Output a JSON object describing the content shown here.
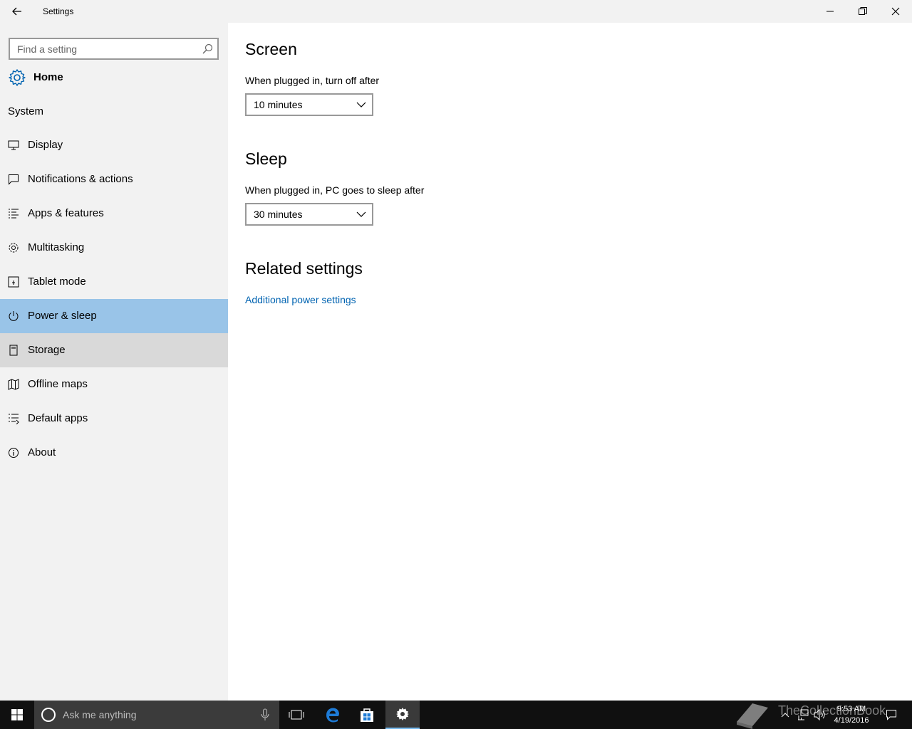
{
  "window": {
    "title": "Settings"
  },
  "sidebar": {
    "search_placeholder": "Find a setting",
    "home_label": "Home",
    "section_label": "System",
    "items": [
      {
        "label": "Display",
        "icon": "monitor-icon"
      },
      {
        "label": "Notifications & actions",
        "icon": "message-icon"
      },
      {
        "label": "Apps & features",
        "icon": "list-icon"
      },
      {
        "label": "Multitasking",
        "icon": "gear-icon"
      },
      {
        "label": "Tablet mode",
        "icon": "tablet-icon"
      },
      {
        "label": "Power & sleep",
        "icon": "power-icon",
        "selected": true
      },
      {
        "label": "Storage",
        "icon": "storage-icon",
        "hovered": true
      },
      {
        "label": "Offline maps",
        "icon": "map-icon"
      },
      {
        "label": "Default apps",
        "icon": "default-apps-icon"
      },
      {
        "label": "About",
        "icon": "info-icon"
      }
    ]
  },
  "main": {
    "screen": {
      "heading": "Screen",
      "label": "When plugged in, turn off after",
      "value": "10 minutes"
    },
    "sleep": {
      "heading": "Sleep",
      "label": "When plugged in, PC goes to sleep after",
      "value": "30 minutes"
    },
    "related": {
      "heading": "Related settings",
      "link": "Additional power settings"
    }
  },
  "taskbar": {
    "search_placeholder": "Ask me anything",
    "time": "9:53 AM",
    "date": "4/19/2016",
    "watermark": "TheCollectionBook"
  },
  "colors": {
    "selected": "#99c4e8",
    "hover": "#d9d9d9",
    "link": "#0063b1",
    "accent": "#76b9ed"
  }
}
